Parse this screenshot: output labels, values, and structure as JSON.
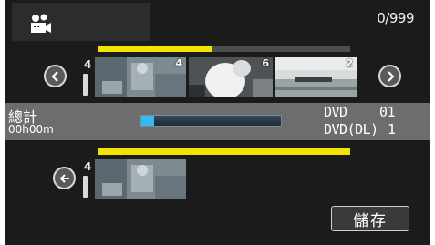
{
  "header": {
    "mode_icon": "video-camera-icon",
    "counter": "0/999"
  },
  "timeline": {
    "top_track_fill": 0.45,
    "marker_left": "4",
    "thumbs": [
      {
        "number": "4",
        "scene": "indoor-figure"
      },
      {
        "number": "6",
        "scene": "white-figure"
      },
      {
        "number": "2",
        "scene": "lake-landscape"
      }
    ],
    "prev_icon": "chevron-left-icon",
    "next_icon": "chevron-right-icon"
  },
  "info": {
    "total_label": "總計",
    "total_time": "00h00m",
    "progress": 0.09,
    "disc1": "DVD",
    "disc1_count": "01",
    "disc2": "DVD(DL)",
    "disc2_count": "1"
  },
  "selected": {
    "back_icon": "back-arrow-icon",
    "marker": "4"
  },
  "actions": {
    "save_label": "儲存"
  },
  "colors": {
    "accent_yellow": "#f2e400",
    "progress_blue": "#38b8f2",
    "background": "#1b1b1b"
  }
}
